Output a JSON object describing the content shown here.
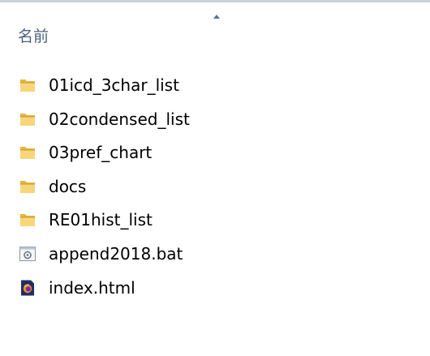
{
  "header": {
    "column_label": "名前",
    "sort_direction": "ascending"
  },
  "files": [
    {
      "name": "01icd_3char_list",
      "icon": "folder-icon"
    },
    {
      "name": "02condensed_list",
      "icon": "folder-icon"
    },
    {
      "name": "03pref_chart",
      "icon": "folder-icon"
    },
    {
      "name": "docs",
      "icon": "folder-icon"
    },
    {
      "name": "RE01hist_list",
      "icon": "folder-icon"
    },
    {
      "name": "append2018.bat",
      "icon": "batch-file-icon"
    },
    {
      "name": "index.html",
      "icon": "html-file-icon"
    }
  ],
  "colors": {
    "folder": "#e7b53f",
    "folder_light": "#f7d67a",
    "header_text": "#4c607a"
  }
}
